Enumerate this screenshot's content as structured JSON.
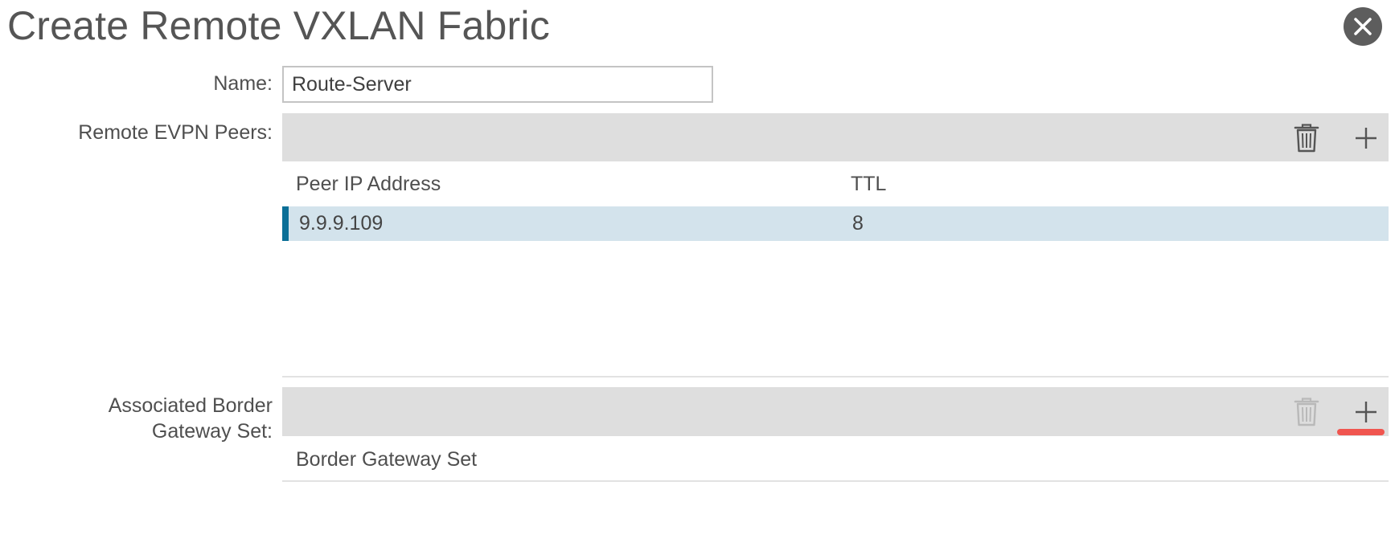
{
  "dialog": {
    "title": "Create Remote VXLAN Fabric",
    "close_icon": "close-icon"
  },
  "form": {
    "name_label": "Name:",
    "name_value": "Route-Server"
  },
  "remote_evpn_peers": {
    "label": "Remote EVPN Peers:",
    "toolbar": {
      "delete_icon": "trash-icon",
      "add_icon": "plus-icon"
    },
    "columns": [
      "Peer IP Address",
      "TTL"
    ],
    "rows": [
      {
        "peer_ip": "9.9.9.109",
        "ttl": "8",
        "selected": true
      }
    ]
  },
  "associated_border_gateway_set": {
    "label_line1": "Associated Border",
    "label_line2": "Gateway Set:",
    "toolbar": {
      "delete_icon": "trash-icon",
      "delete_disabled": true,
      "add_icon": "plus-icon"
    },
    "columns": [
      "Border Gateway Set"
    ],
    "rows": []
  },
  "colors": {
    "accent": "#0a6f97",
    "selected_row": "#d3e3ec",
    "toolbar_bg": "#dedede",
    "highlight": "#f0554f"
  }
}
